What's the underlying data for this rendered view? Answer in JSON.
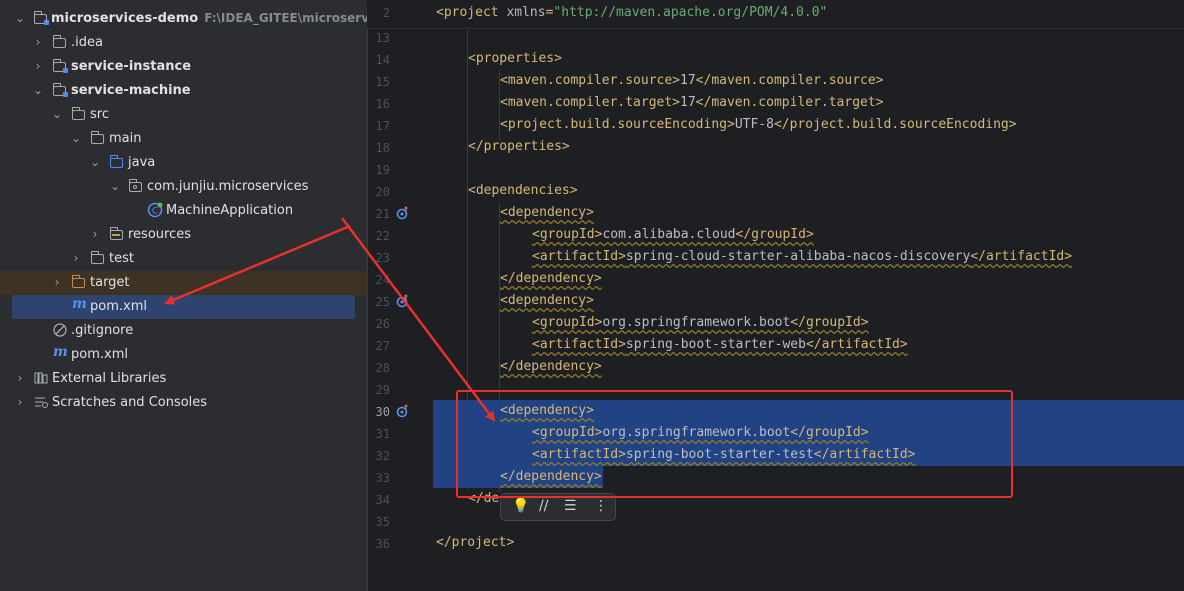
{
  "project_tree": {
    "root": {
      "name": "microservices-demo",
      "path": "F:\\IDEA_GITEE\\microservices-de"
    },
    "items": [
      {
        "label": ".idea",
        "type": "folder"
      },
      {
        "label": "service-instance",
        "type": "module"
      },
      {
        "label": "service-machine",
        "type": "module"
      },
      {
        "label": "src",
        "type": "folder"
      },
      {
        "label": "main",
        "type": "folder"
      },
      {
        "label": "java",
        "type": "source-folder"
      },
      {
        "label": "com.junjiu.microservices",
        "type": "package"
      },
      {
        "label": "MachineApplication",
        "type": "spring-class"
      },
      {
        "label": "resources",
        "type": "resources-folder"
      },
      {
        "label": "test",
        "type": "folder"
      },
      {
        "label": "target",
        "type": "excluded-folder"
      },
      {
        "label": "pom.xml",
        "type": "maven-file",
        "selected": true
      },
      {
        "label": ".gitignore",
        "type": "ignore-file"
      },
      {
        "label": "pom.xml",
        "type": "maven-file"
      },
      {
        "label": "External Libraries",
        "type": "libraries"
      },
      {
        "label": "Scratches and Consoles",
        "type": "scratches"
      }
    ]
  },
  "editor": {
    "lines": [
      {
        "num": "2",
        "text": "<project xmlns=\"http://maven.apache.org/POM/4.0.0\""
      },
      {
        "num": "13",
        "text": ""
      },
      {
        "num": "14",
        "text": "<properties>"
      },
      {
        "num": "15",
        "text": "<maven.compiler.source>17</maven.compiler.source>"
      },
      {
        "num": "16",
        "text": "<maven.compiler.target>17</maven.compiler.target>"
      },
      {
        "num": "17",
        "text": "<project.build.sourceEncoding>UTF-8</project.build.sourceEncoding>"
      },
      {
        "num": "18",
        "text": "</properties>"
      },
      {
        "num": "19",
        "text": ""
      },
      {
        "num": "20",
        "text": "<dependencies>"
      },
      {
        "num": "21",
        "text": "<dependency>"
      },
      {
        "num": "22",
        "text": "<groupId>com.alibaba.cloud</groupId>"
      },
      {
        "num": "23",
        "text": "<artifactId>spring-cloud-starter-alibaba-nacos-discovery</artifactId>"
      },
      {
        "num": "24",
        "text": "</dependency>"
      },
      {
        "num": "25",
        "text": "<dependency>"
      },
      {
        "num": "26",
        "text": "<groupId>org.springframework.boot</groupId>"
      },
      {
        "num": "27",
        "text": "<artifactId>spring-boot-starter-web</artifactId>"
      },
      {
        "num": "28",
        "text": "</dependency>"
      },
      {
        "num": "29",
        "text": ""
      },
      {
        "num": "30",
        "text": "<dependency>"
      },
      {
        "num": "31",
        "text": "<groupId>org.springframework.boot</groupId>"
      },
      {
        "num": "32",
        "text": "<artifactId>spring-boot-starter-test</artifactId>"
      },
      {
        "num": "33",
        "text": "</dependency>"
      },
      {
        "num": "34",
        "text": "</de"
      },
      {
        "num": "35",
        "text": ""
      },
      {
        "num": "36",
        "text": "</project>"
      }
    ]
  },
  "colors": {
    "selection": "#214283",
    "annotation": "#e8302c",
    "tag": "#d5b778",
    "attr_value": "#6aab73"
  }
}
